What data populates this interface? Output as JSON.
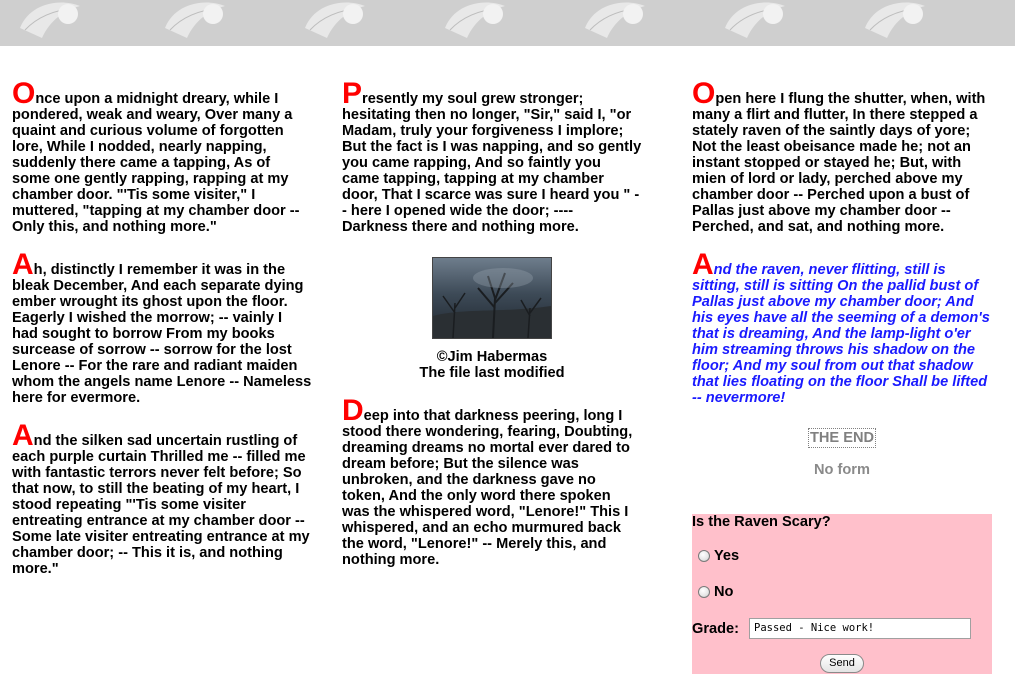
{
  "stanzas": {
    "s1": {
      "initial": "O",
      "text": "nce upon a midnight dreary, while I pondered, weak and weary, Over many a quaint and curious volume of forgotten lore, While I nodded, nearly napping, suddenly there came a tapping, As of some one gently rapping, rapping at my chamber door. \"'Tis some visiter,\" I muttered, \"tapping at my chamber door -- Only this, and nothing more.\""
    },
    "s2": {
      "initial": "A",
      "text": "h, distinctly I remember it was in the bleak December, And each separate dying ember wrought its ghost upon the floor. Eagerly I wished the morrow; -- vainly I had sought to borrow From my books surcease of sorrow -- sorrow for the lost Lenore -- For the rare and radiant maiden whom the angels name Lenore -- Nameless here for evermore."
    },
    "s3": {
      "initial": "A",
      "text": "nd the silken sad uncertain rustling of each purple curtain Thrilled me -- filled me with fantastic terrors never felt before; So that now, to still the beating of my heart, I stood repeating \"'Tis some visiter entreating entrance at my chamber door -- Some late visiter entreating entrance at my chamber door; -- This it is, and nothing more.\""
    },
    "s4": {
      "initial": "P",
      "text": "resently my soul grew stronger; hesitating then no longer, \"Sir,\" said I, \"or Madam, truly your forgiveness I implore; But the fact is I was napping, and so gently you came rapping, And so faintly you came tapping, tapping at my chamber door, That I scarce was sure I heard you \" -- here I opened wide the door; ---- Darkness there and nothing more."
    },
    "s5": {
      "initial": "D",
      "text": "eep into that darkness peering, long I stood there wondering, fearing, Doubting, dreaming dreams no mortal ever dared to dream before; But the silence was unbroken, and the darkness gave no token, And the only word there spoken was the whispered word, \"Lenore!\" This I whispered, and an echo murmured back the word, \"Lenore!\" -- Merely this, and nothing more."
    },
    "s6": {
      "initial": "O",
      "text": "pen here I flung the shutter, when, with many a flirt and flutter, In there stepped a stately raven of the saintly days of yore; Not the least obeisance made he; not an instant stopped or stayed he; But, with mien of lord or lady, perched above my chamber door -- Perched upon a bust of Pallas just above my chamber door -- Perched, and sat, and nothing more."
    },
    "s7": {
      "initial": "A",
      "text": "nd the raven, never flitting, still is sitting, still is sitting On the pallid bust of Pallas just above my chamber door; And his eyes have all the seeming of a demon's that is dreaming, And the lamp-light o'er him streaming throws his shadow on the floor; And my soul from out that shadow that lies floating on the floor Shall be lifted -- nevermore!"
    }
  },
  "photo": {
    "credit": "©Jim Habermas",
    "modified": "The file last modified"
  },
  "the_end": "THE END",
  "no_form": "No form",
  "quiz": {
    "question": "Is the Raven Scary?",
    "options": [
      "Yes",
      "No"
    ],
    "grade_label": "Grade:",
    "grade_value": "Passed - Nice work!",
    "send_label": "Send"
  },
  "colors": {
    "drop_cap": "#ff0000",
    "final_stanza": "#1a1aff",
    "quiz_bg": "#ffc0cb",
    "banner": "#cfcfcf"
  }
}
